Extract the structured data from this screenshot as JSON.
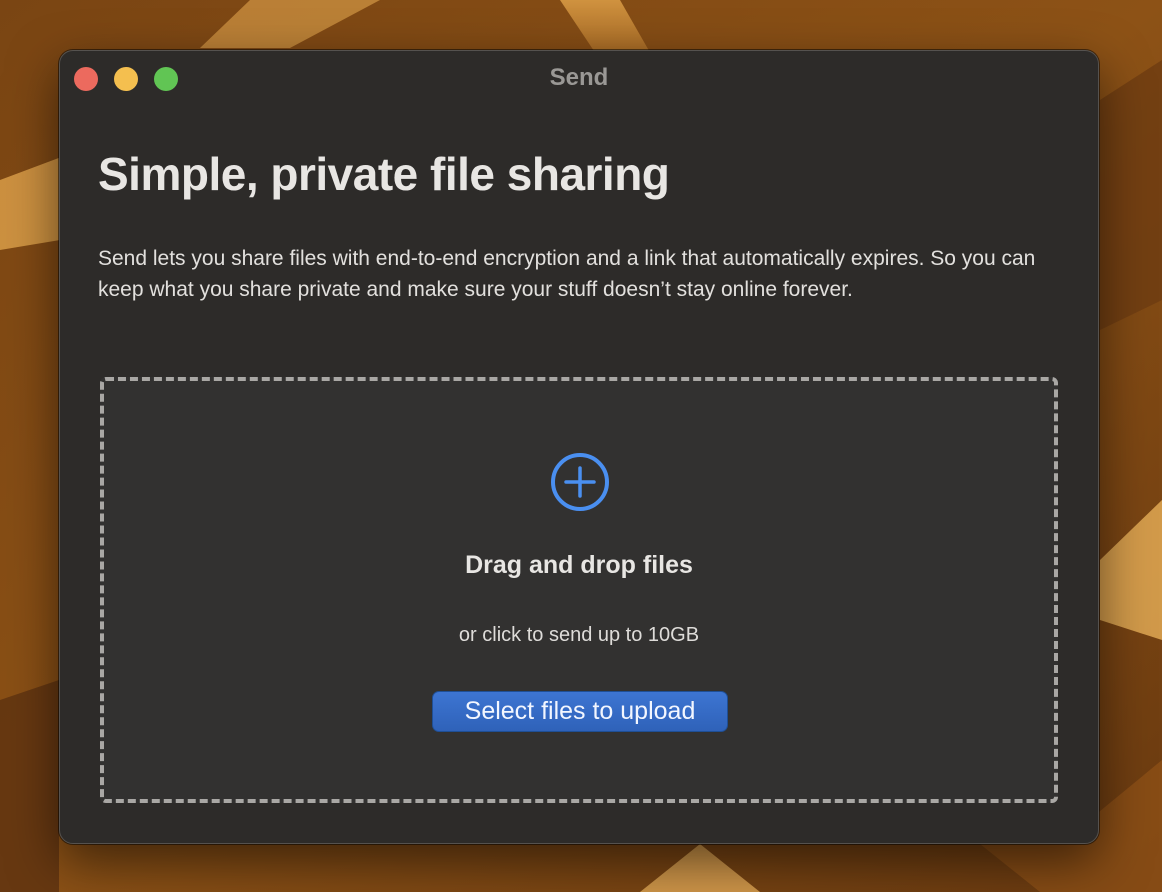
{
  "window": {
    "title": "Send"
  },
  "content": {
    "headline": "Simple, private file sharing",
    "description": "Send lets you share files with end-to-end encryption and a link that automatically expires. So you can keep what you share private and make sure your stuff doesn’t stay online forever."
  },
  "dropzone": {
    "icon": "plus-circle-icon",
    "title": "Drag and drop files",
    "subtitle": "or click to send up to 10GB",
    "button_label": "Select files to upload"
  },
  "colors": {
    "accent": "#3b6fcb",
    "icon_accent": "#4a8ff0",
    "window_bg": "#2d2b29",
    "close": "#ec6a5e",
    "minimize": "#f4bf4f",
    "maximize": "#61c554"
  }
}
